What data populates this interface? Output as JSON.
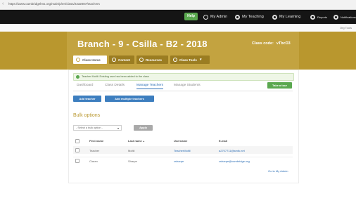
{
  "browser": {
    "url": "https://www.cambridgelms.org/main/p/en/class/2332087/teachers"
  },
  "topnav": {
    "help": "Help",
    "items": [
      "My Admin",
      "My Teaching",
      "My Learning",
      "Reports",
      "Notifications"
    ]
  },
  "org": {
    "label": "Org Tools"
  },
  "header": {
    "title": "Branch - 9 - Csilla - B2 - 2018",
    "class_code_label": "Class code:",
    "class_code_value": "vTbcD3"
  },
  "class_tabs": [
    "Class Home",
    "Content",
    "Resources",
    "Class Tools"
  ],
  "alert": {
    "text": "Teacher Moltil: Existing user has been added to the class"
  },
  "subtabs": [
    "Dashboard",
    "Class Details",
    "Manage Teachers",
    "Manage Students"
  ],
  "tour_button": "Take a tour",
  "buttons": {
    "add_teacher": "Add teacher",
    "add_multiple": "Add multiple teachers"
  },
  "bulk": {
    "title": "Bulk options",
    "select_placeholder": "- Select a bulk option -",
    "apply": "Apply"
  },
  "table": {
    "headers": [
      "First name",
      "Last name",
      "Username",
      "E-mail"
    ],
    "sort_indicator": "▲",
    "rows": [
      [
        "Teacher",
        "Moltil",
        "TeacherMoltil",
        "a2707711@smtk.net"
      ],
      [
        "Ciaran",
        "Sharpe",
        "csharpe",
        "csharpe@cambridge.org"
      ]
    ]
  },
  "go_admin": "Go to My Admin",
  "colors": {
    "gold": "#c3a340",
    "blue": "#3d7ebf",
    "green": "#5aa84f",
    "nav": "#151515"
  }
}
